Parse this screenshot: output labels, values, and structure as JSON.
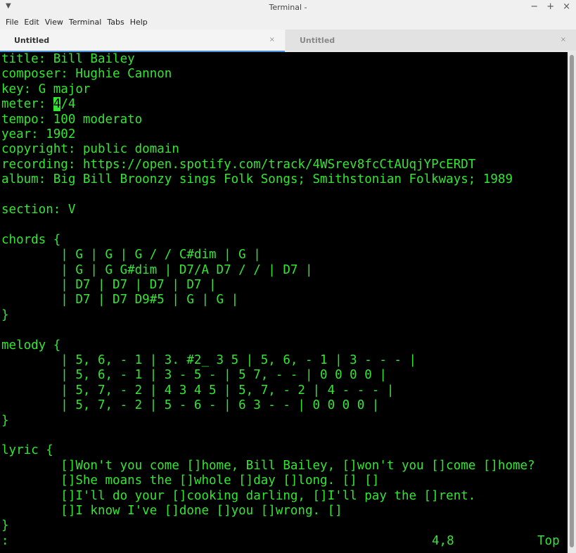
{
  "window": {
    "title": "Terminal -",
    "controls": [
      "−",
      "+",
      "×"
    ]
  },
  "menubar": [
    "File",
    "Edit",
    "View",
    "Terminal",
    "Tabs",
    "Help"
  ],
  "tabs": [
    {
      "label": "Untitled",
      "active": true
    },
    {
      "label": "Untitled",
      "active": false
    }
  ],
  "terminal": {
    "colors": {
      "background": "#000000",
      "foreground": "#32e632"
    },
    "lines": [
      "title: Bill Bailey",
      "composer: Hughie Cannon",
      "key: G major",
      "meter: 4/4",
      "tempo: 100 moderato",
      "year: 1902",
      "copyright: public domain",
      "recording: https://open.spotify.com/track/4WSrev8fcCtAUqjYPcERDT",
      "album: Big Bill Broonzy sings Folk Songs; Smithstonian Folkways; 1989",
      "",
      "section: V",
      "",
      "chords {",
      "        | G | G | G / / C#dim | G |",
      "        | G | G G#dim | D7/A D7 / / | D7 |",
      "        | D7 | D7 | D7 | D7 |",
      "        | D7 | D7 D9#5 | G | G |",
      "}",
      "",
      "melody {",
      "        | 5, 6, - 1 | 3. #2_ 3 5 | 5, 6, - 1 | 3 - - - |",
      "        | 5, 6, - 1 | 3 - 5 - | 5 7, - - | 0 0 0 0 |",
      "        | 5, 7, - 2 | 4 3 4 5 | 5, 7, - 2 | 4 - - - |",
      "        | 5, 7, - 2 | 5 - 6 - | 6 3 - - | 0 0 0 0 |",
      "}",
      "",
      "lyric {",
      "        []Won't you come []home, Bill Bailey, []won't you []come []home?",
      "        []She moans the []whole []day []long. [] []",
      "        []I'll do your []cooking darling, []I'll pay the []rent.",
      "        []I know I've []done []you []wrong. []",
      "}"
    ],
    "cursor_line": {
      "before": "meter: ",
      "char": "4",
      "after": "/4"
    },
    "status": {
      "left": ":",
      "position": "4,8",
      "scroll": "Top"
    }
  }
}
